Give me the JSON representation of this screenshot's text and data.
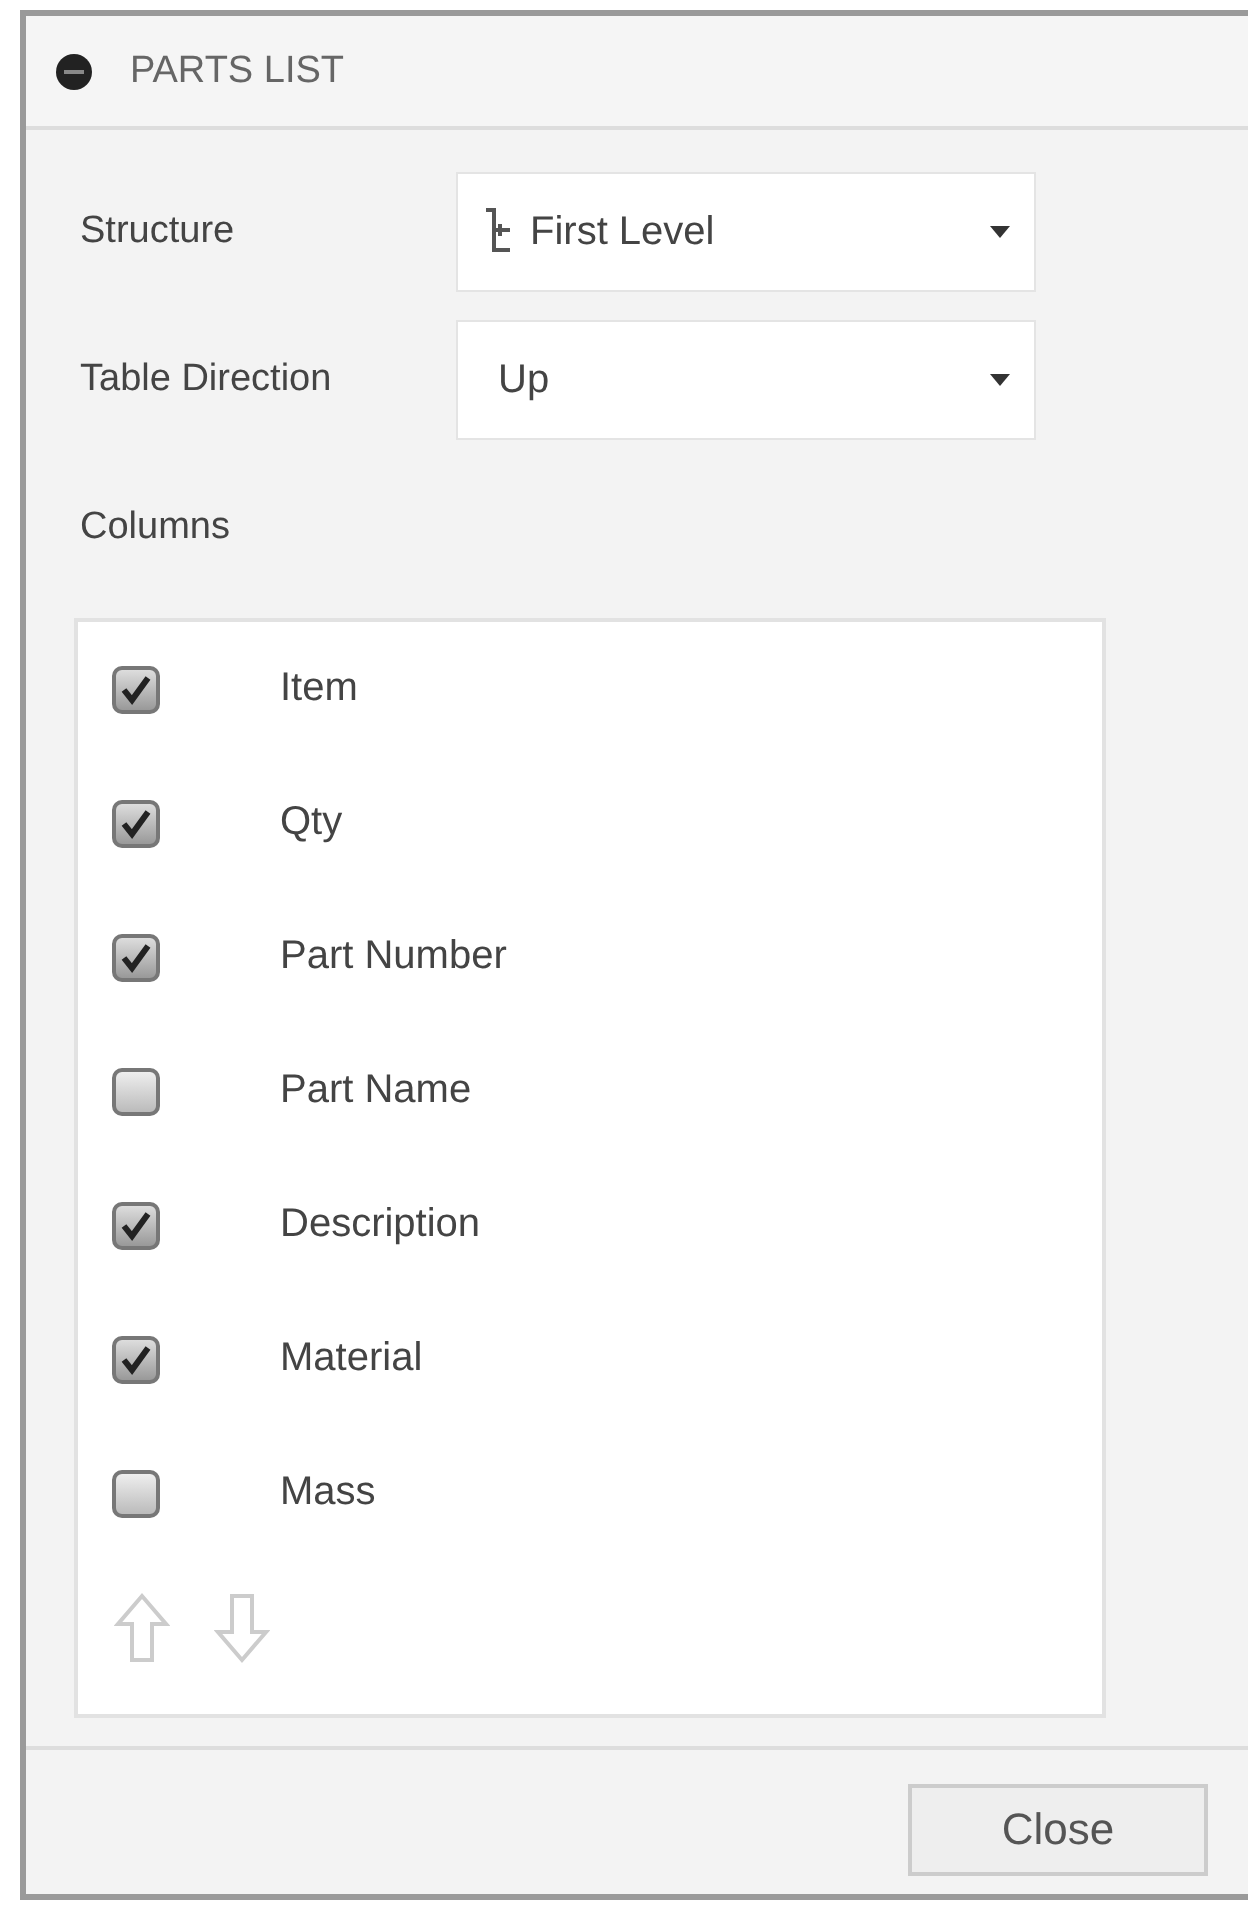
{
  "dialog": {
    "title": "PARTS LIST"
  },
  "fields": [
    {
      "kind": "tree",
      "label": "Structure",
      "value": "First Level"
    },
    {
      "kind": "plain",
      "label": "Table Direction",
      "value": "Up"
    }
  ],
  "columns_label": "Columns",
  "columns": [
    {
      "label": "Item",
      "checked": true
    },
    {
      "label": "Qty",
      "checked": true
    },
    {
      "label": "Part Number",
      "checked": true
    },
    {
      "label": "Part Name",
      "checked": false
    },
    {
      "label": "Description",
      "checked": true
    },
    {
      "label": "Material",
      "checked": true
    },
    {
      "label": "Mass",
      "checked": false
    }
  ],
  "buttons": [
    "Close"
  ]
}
